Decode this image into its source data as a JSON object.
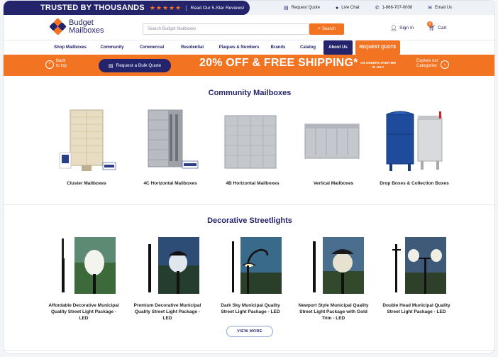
{
  "topbar": {
    "trust_title": "TRUSTED BY THOUSANDS",
    "stars": "★★★★★",
    "divider": "|",
    "reviews_link": "Read Our 5-Star Reviews!",
    "request_quote": "Request Quote",
    "live_chat": "Live Chat",
    "phone": "1-866-707-0008",
    "email": "Email Us"
  },
  "header": {
    "logo_line1": "Budget",
    "logo_line2": "Mailboxes",
    "search_placeholder": "Search Budget Mailboxes",
    "search_button": "Search",
    "sign_in": "Sign In",
    "cart": "Cart",
    "cart_count": "0"
  },
  "nav": {
    "items": [
      "Shop Mailboxes",
      "Community",
      "Commercial",
      "Residential",
      "Plaques & Numbers",
      "Brands",
      "Catalog",
      "About Us",
      "REQUEST QUOTE"
    ]
  },
  "promo": {
    "back_line1": "Back",
    "back_line2": "to top",
    "bulk_quote": "Request a Bulk Quote",
    "headline": "20% OFF & FREE SHIPPING*",
    "fine_line1": "ON ORDERS OVER $99",
    "fine_line2": "IN JULY",
    "explore_line1": "Explore our",
    "explore_line2": "Categories"
  },
  "community": {
    "title": "Community Mailboxes",
    "products": [
      "Cluster Mailboxes",
      "4C Horizontal Mailboxes",
      "4B Horizontal Mailboxes",
      "Vertical Mailboxes",
      "Drop Boxes & Collection Boxes"
    ]
  },
  "streetlights": {
    "title": "Decorative Streetlights",
    "products": [
      [
        "Affordable Decorative Municipal",
        "Quality Street Light Package -",
        "LED"
      ],
      [
        "Premium Decorative Municipal",
        "Quality Street Light Package -",
        "LED"
      ],
      [
        "Dark Sky Municipal Quality",
        "Street Light Package - LED",
        ""
      ],
      [
        "Newport Style Municipal Quality",
        "Street Light Package with Gold",
        "Trim - LED"
      ],
      [
        "Double Head Municipal Quality",
        "Street Light Package - LED",
        ""
      ]
    ],
    "view_more": "VIEW MORE"
  },
  "colors": {
    "navy": "#24246d",
    "orange": "#f27322"
  }
}
